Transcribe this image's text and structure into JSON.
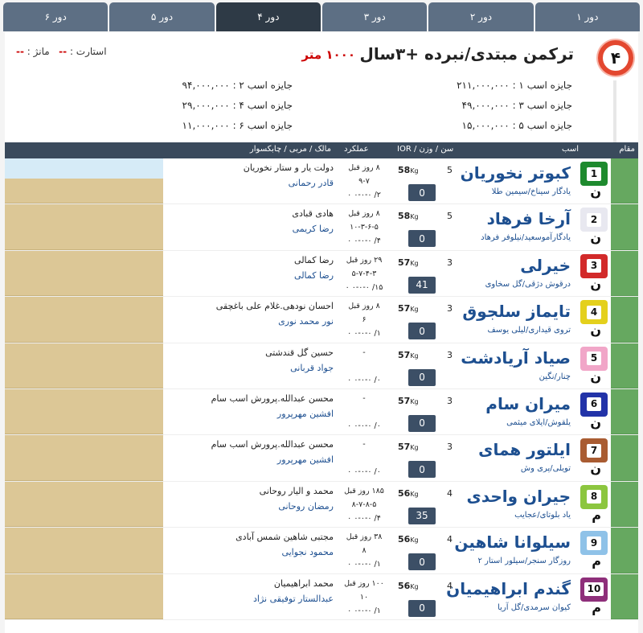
{
  "tabs": [
    "دور ۱",
    "دور ۲",
    "دور ۳",
    "دور ۴",
    "دور ۵",
    "دور ۶"
  ],
  "active_tab_index": 3,
  "race": {
    "number": "۴",
    "title": "ترکمن مبتدی/نبرده +۳سال",
    "distance": "۱۰۰۰ متر",
    "start_label": "استارت :",
    "start_value": "--",
    "manz_label": "مانژ :",
    "manz_value": "--"
  },
  "prizes": {
    "p1": "جایزه اسب ۱ : ۲۱۱,۰۰۰,۰۰۰",
    "p2": "جایزه اسب ۲ : ۹۴,۰۰۰,۰۰۰",
    "p3": "جایزه اسب ۳ : ۴۹,۰۰۰,۰۰۰",
    "p4": "جایزه اسب ۴ : ۲۹,۰۰۰,۰۰۰",
    "p5": "جایزه اسب ۵ : ۱۵,۰۰۰,۰۰۰",
    "p6": "جایزه اسب ۶ : ۱۱,۰۰۰,۰۰۰"
  },
  "table_headers": {
    "rank": "مقام",
    "horse": "اسب",
    "age_weight": "سن / وزن / IOR",
    "performance": "عملکرد",
    "owner": "مالک / مربی / چابکسوار"
  },
  "colors": {
    "tab": "#5d6f84",
    "tab_active": "#2e3a46",
    "header": "#3a4a5c",
    "rank_green": "#66a860",
    "tan": "#dcc796",
    "link_blue": "#1d4f90",
    "accent_red": "#e3472f"
  },
  "horses": [
    {
      "num": "1",
      "color": "#1e8a2e",
      "sex": "ن",
      "name": "کبوتر نخوریان",
      "pedigree": "یادگار سیناخ/سیمین طلا",
      "age": "5",
      "weight": "58",
      "weight_unit": "Kg",
      "ior": "0",
      "perf1": "۸ روز قبل",
      "perf2": "۹-۷",
      "perf3": "۲/ ۰-۰-۰ ۰",
      "owner": "دولت یار و ستار نخوریان",
      "trainer": "قادر رحمانی"
    },
    {
      "num": "2",
      "color": "#e8e8f0",
      "sex": "ن",
      "name": "آرخا فرهاد",
      "pedigree": "یادگارآموسعید/نیلوفر فرهاد",
      "age": "5",
      "weight": "58",
      "weight_unit": "Kg",
      "ior": "0",
      "perf1": "۸ روز قبل",
      "perf2": "۱۰-۳-۶-۵",
      "perf3": "۴/ ۰-۰-۰ ۰",
      "owner": "هادی قبادی",
      "trainer": "رضا کریمی"
    },
    {
      "num": "3",
      "color": "#d22a2a",
      "sex": "ن",
      "name": "خیرلی",
      "pedigree": "درقوش دژقی/گل سخاوی",
      "age": "3",
      "weight": "57",
      "weight_unit": "Kg",
      "ior": "41",
      "perf1": "۲۹ روز قبل",
      "perf2": "۵-۷-۴-۳",
      "perf3": "۱۵/ ۰-۰-۰ ۰",
      "owner": "رضا کمالی",
      "trainer": "رضا کمالی"
    },
    {
      "num": "4",
      "color": "#e4d01c",
      "sex": "ن",
      "name": "تایماز سلجوق",
      "pedigree": "تروی قیداری/لیلی یوسف",
      "age": "3",
      "weight": "57",
      "weight_unit": "Kg",
      "ior": "0",
      "perf1": "۸ روز قبل",
      "perf2": "۶",
      "perf3": "۱/ ۰-۰-۰ ۰",
      "owner": "احسان نودهی.غلام علی باغچقی",
      "trainer": "نور محمد نوری"
    },
    {
      "num": "5",
      "color": "#f1a6c8",
      "sex": "ن",
      "name": "صیاد آریادشت",
      "pedigree": "چنار/نگین",
      "age": "3",
      "weight": "57",
      "weight_unit": "Kg",
      "ior": "0",
      "perf1": "-",
      "perf2": "",
      "perf3": "۰/ ۰-۰-۰ ۰",
      "owner": "حسین گل قندشتی",
      "trainer": "جواد قربانی"
    },
    {
      "num": "6",
      "color": "#2233a8",
      "sex": "ن",
      "name": "میران سام",
      "pedigree": "یلقوش/ایلای میثمی",
      "age": "3",
      "weight": "57",
      "weight_unit": "Kg",
      "ior": "0",
      "perf1": "-",
      "perf2": "",
      "perf3": "۰/ ۰-۰-۰ ۰",
      "owner": "محسن عبدالله.پرورش اسب سام",
      "trainer": "افشین مهرپرور"
    },
    {
      "num": "7",
      "color": "#a95c32",
      "sex": "ن",
      "name": "ایلتور همای",
      "pedigree": "تویلی/پری وش",
      "age": "3",
      "weight": "57",
      "weight_unit": "Kg",
      "ior": "0",
      "perf1": "-",
      "perf2": "",
      "perf3": "۰/ ۰-۰-۰ ۰",
      "owner": "محسن عبدالله.پرورش اسب سام",
      "trainer": "افشین مهرپرور"
    },
    {
      "num": "8",
      "color": "#8cc63f",
      "sex": "م",
      "name": "جیران واحدی",
      "pedigree": "یاد بلوتای/عجایب",
      "age": "4",
      "weight": "56",
      "weight_unit": "Kg",
      "ior": "35",
      "perf1": "۱۸۵ روز قبل",
      "perf2": "۸-۷-۸-۵",
      "perf3": "۴/ ۰-۰-۰ ۰",
      "owner": "محمد و الیار روحانی",
      "trainer": "رمضان روحانی"
    },
    {
      "num": "9",
      "color": "#8fc2e8",
      "sex": "م",
      "name": "سیلوانا شاهین",
      "pedigree": "روزگار سنجر/سیلور استار ۲",
      "age": "4",
      "weight": "56",
      "weight_unit": "Kg",
      "ior": "0",
      "perf1": "۳۸ روز قبل",
      "perf2": "۸",
      "perf3": "۱/ ۰-۰-۰ ۰",
      "owner": "مجتبی شاهین شمس آبادی",
      "trainer": "محمود نجوایی"
    },
    {
      "num": "10",
      "color": "#8e2f7a",
      "sex": "م",
      "name": "گندم ابراهیمیان",
      "pedigree": "کیوان سرمدی/گل آریا",
      "age": "4",
      "weight": "56",
      "weight_unit": "Kg",
      "ior": "0",
      "perf1": "۱۰۰ روز قبل",
      "perf2": "۱۰",
      "perf3": "۱/ ۰-۰-۰ ۰",
      "owner": "محمد ابراهیمیان",
      "trainer": "عبدالستار توفیقی نژاد"
    }
  ]
}
